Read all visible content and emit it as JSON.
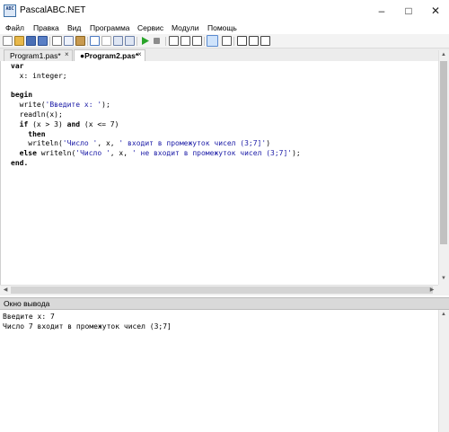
{
  "window": {
    "title": "PascalABC.NET",
    "icon_label": "ABC",
    "minimize": "–",
    "maximize": "□",
    "close": "✕"
  },
  "menu": {
    "file": "Файл",
    "edit": "Правка",
    "view": "Вид",
    "program": "Программа",
    "service": "Сервис",
    "modules": "Модули",
    "help": "Помощь"
  },
  "toolbar_icons": [
    "new-file-icon",
    "open-folder-icon",
    "save-icon",
    "save-all-icon",
    "cut-icon",
    "copy-icon",
    "paste-icon",
    "undo-icon",
    "redo-icon",
    "find-icon",
    "replace-icon",
    "run-icon",
    "stop-icon",
    "step-into-icon",
    "step-over-icon",
    "toggle-output-icon",
    "intellisense-icon",
    "form-designer-icon",
    "help-icon"
  ],
  "tabs": {
    "tab1": "Program1.pas*",
    "tab2": "●Program2.pas*",
    "close_glyph": "×"
  },
  "code": {
    "l1": "var",
    "l2": "  x: integer;",
    "l4": "begin",
    "l5_a": "  write(",
    "l5_s": "'Введите x: '",
    "l5_b": ");",
    "l6": "  readln(x);",
    "l7_a": "  if",
    "l7_b": " (x > 3) ",
    "l7_c": "and",
    "l7_d": " (x <= 7)",
    "l8": "    then",
    "l9_a": "    writeln(",
    "l9_s1": "'Число '",
    "l9_b": ", x, ",
    "l9_s2": "' входит в промежуток чисел (3;7]'",
    "l9_c": ")",
    "l10_a": "  else",
    "l10_b": " writeln(",
    "l10_s1": "'Число '",
    "l10_c": ", x, ",
    "l10_s2": "' не входит в промежуток чисел (3;7]'",
    "l10_d": ");",
    "l11": "end."
  },
  "output_pane": {
    "title": "Окно вывода",
    "line1": "Введите x: 7",
    "line2": "Число 7 входит в промежуток чисел (3;7]"
  },
  "colors": {
    "string": "#1a1aa6",
    "accent": "#3a6ea5"
  }
}
